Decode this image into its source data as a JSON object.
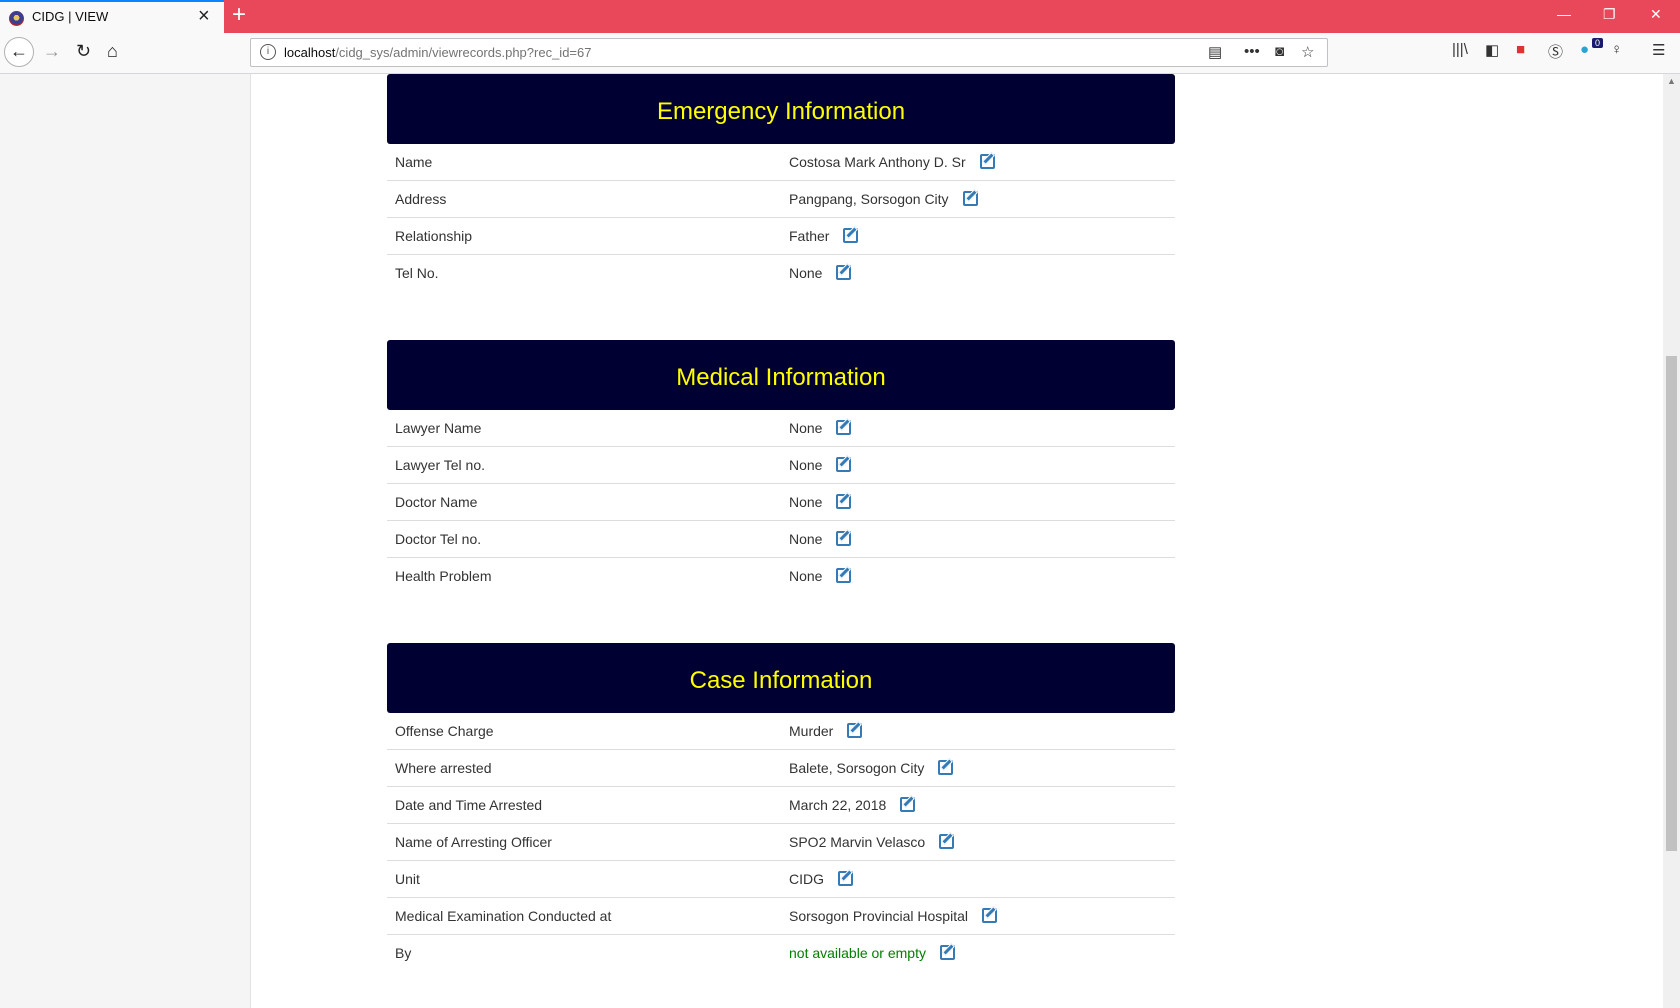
{
  "browser": {
    "tab_title": "CIDG | VIEW",
    "url_host": "localhost",
    "url_path": "/cidg_sys/admin/viewrecords.php?rec_id=67",
    "badge_count": "0"
  },
  "emergency": {
    "title": "Emergency Information",
    "rows": [
      {
        "label": "Name",
        "value": "Costosa Mark Anthony D. Sr"
      },
      {
        "label": "Address",
        "value": "Pangpang, Sorsogon City"
      },
      {
        "label": "Relationship",
        "value": "Father"
      },
      {
        "label": "Tel No.",
        "value": "None"
      }
    ]
  },
  "medical": {
    "title": "Medical Information",
    "rows": [
      {
        "label": "Lawyer Name",
        "value": "None"
      },
      {
        "label": "Lawyer Tel no.",
        "value": "None"
      },
      {
        "label": "Doctor Name",
        "value": "None"
      },
      {
        "label": "Doctor Tel no.",
        "value": "None"
      },
      {
        "label": "Health Problem",
        "value": "None"
      }
    ]
  },
  "case": {
    "title": "Case Information",
    "rows": [
      {
        "label": "Offense Charge",
        "value": "Murder"
      },
      {
        "label": "Where arrested",
        "value": "Balete, Sorsogon City"
      },
      {
        "label": "Date and Time Arrested",
        "value": "March 22, 2018"
      },
      {
        "label": "Name of Arresting Officer",
        "value": "SPO2 Marvin Velasco"
      },
      {
        "label": "Unit",
        "value": "CIDG"
      },
      {
        "label": "Medical Examination Conducted at",
        "value": "Sorsogon Provincial Hospital"
      },
      {
        "label": "By",
        "value": "not available or empty"
      }
    ]
  },
  "colors": {
    "panel_header_bg": "#000033",
    "panel_header_text": "#ffff00",
    "edit_icon": "#337ab7",
    "empty_value": "#008000",
    "tab_bar": "#e8485a"
  }
}
